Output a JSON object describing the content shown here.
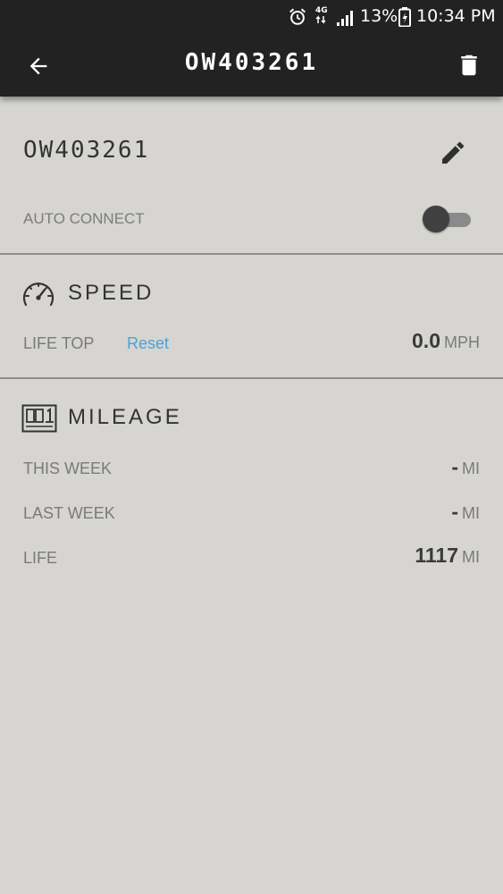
{
  "status_bar": {
    "network": "4G",
    "battery_percent": "13%",
    "time": "10:34 PM"
  },
  "app_bar": {
    "title": "OW403261"
  },
  "device": {
    "name": "OW403261",
    "auto_connect_label": "AUTO CONNECT",
    "auto_connect_enabled": false
  },
  "speed": {
    "title": "SPEED",
    "life_top_label": "LIFE TOP",
    "reset_label": "Reset",
    "life_top_value": "0.0",
    "unit": "MPH"
  },
  "mileage": {
    "title": "MILEAGE",
    "rows": [
      {
        "label": "THIS WEEK",
        "value": "-",
        "unit": "MI"
      },
      {
        "label": "LAST WEEK",
        "value": "-",
        "unit": "MI"
      },
      {
        "label": "LIFE",
        "value": "1117",
        "unit": "MI"
      }
    ]
  },
  "icons": {
    "back": "arrow-left-icon",
    "delete": "trash-icon",
    "edit": "pencil-icon",
    "speed": "speedometer-icon",
    "mileage": "odometer-icon"
  },
  "colors": {
    "app_bar": "#222222",
    "background": "#d6d5d1",
    "link": "#4aa3d6"
  }
}
